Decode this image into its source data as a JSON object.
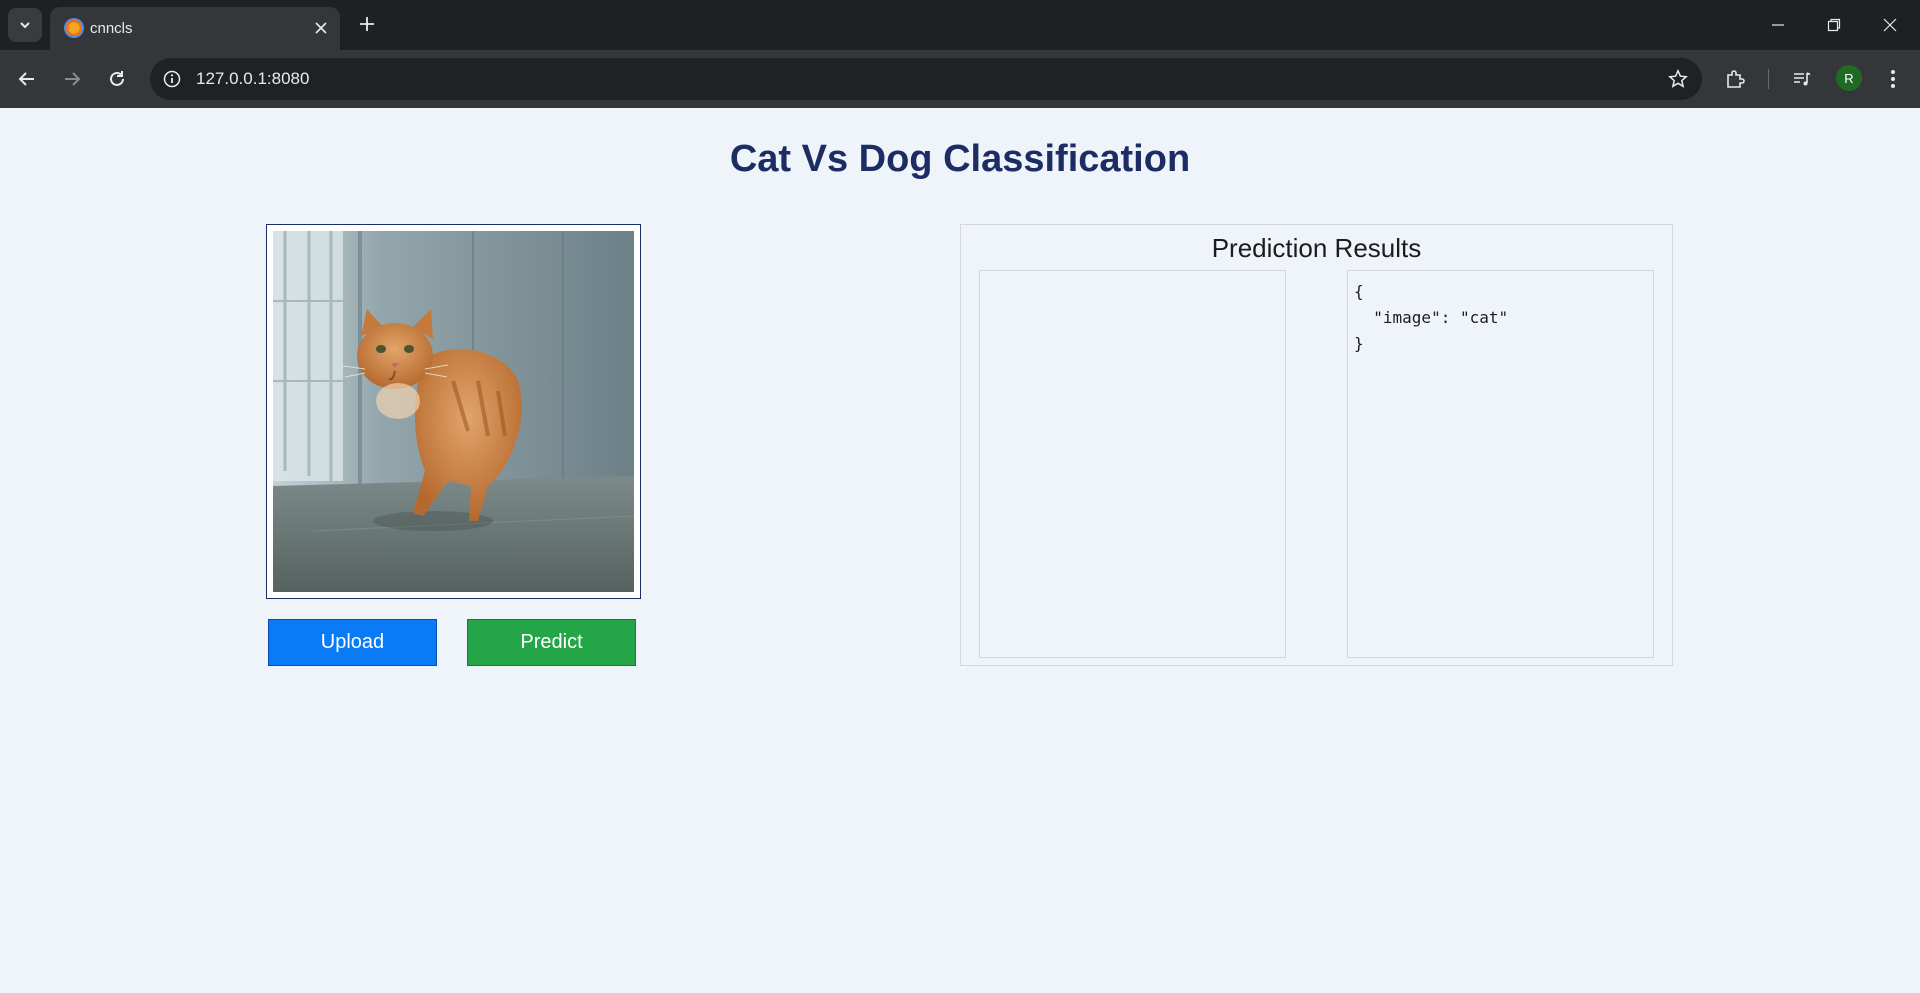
{
  "browser": {
    "tab_title": "cnncls",
    "url": "127.0.0.1:8080",
    "profile_initial": "R",
    "icons": [
      "tab-search-icon",
      "favicon-icon",
      "close-tab-icon",
      "new-tab-icon",
      "minimize-icon",
      "restore-icon",
      "close-window-icon",
      "back-icon",
      "forward-icon",
      "reload-icon",
      "site-info-icon",
      "bookmark-star-icon",
      "extensions-icon",
      "media-controls-icon",
      "menu-icon"
    ]
  },
  "page": {
    "title": "Cat Vs Dog Classification",
    "upload_label": "Upload",
    "predict_label": "Predict",
    "results_title": "Prediction Results",
    "json_output": "{\n  \"image\": \"cat\"\n}"
  },
  "colors": {
    "title": "#1b2d63",
    "upload_button": "#0a7bf7",
    "predict_button": "#24a648",
    "page_background": "#eff3fa"
  }
}
